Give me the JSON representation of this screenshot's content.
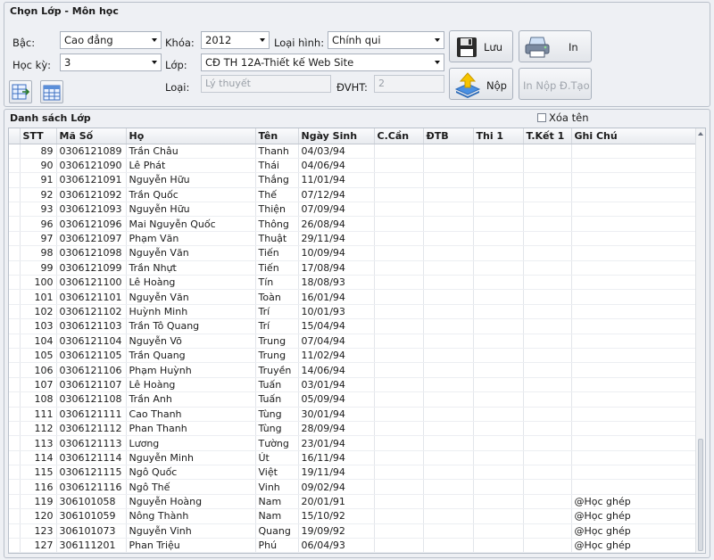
{
  "top": {
    "title": "Chọn Lớp - Môn học",
    "bac": {
      "label": "Bậc:",
      "value": "Cao đẳng"
    },
    "hocky": {
      "label": "Học kỳ:",
      "value": "3"
    },
    "khoa": {
      "label": "Khóa:",
      "value": "2012"
    },
    "loaihinh": {
      "label": "Loại hình:",
      "value": "Chính qui"
    },
    "lop": {
      "label": "Lớp:",
      "value": "CĐ TH 12A-Thiết kế Web Site"
    },
    "loai": {
      "label": "Loại:",
      "value": "Lý thuyết"
    },
    "dvht": {
      "label": "ĐVHT:",
      "value": "2"
    },
    "buttons": {
      "luu": "Lưu",
      "in": "In",
      "nop": "Nộp",
      "in_nop": "In Nộp Đ.Tạo"
    }
  },
  "list": {
    "title": "Danh sách Lớp",
    "xoa_ten_label": "Xóa tên",
    "columns": [
      "STT",
      "Mã Số",
      "Họ",
      "Tên",
      "Ngày Sinh",
      "C.Cần",
      "ĐTB",
      "Thi 1",
      "T.Kết 1",
      "Ghi Chú"
    ],
    "rows": [
      [
        "89",
        "0306121089",
        "Trần Châu",
        "Thanh",
        "04/03/94",
        "",
        "",
        "",
        "",
        ""
      ],
      [
        "90",
        "0306121090",
        "Lê Phát",
        "Thái",
        "04/06/94",
        "",
        "",
        "",
        "",
        ""
      ],
      [
        "91",
        "0306121091",
        "Nguyễn Hữu",
        "Thắng",
        "11/01/94",
        "",
        "",
        "",
        "",
        ""
      ],
      [
        "92",
        "0306121092",
        "Trần Quốc",
        "Thế",
        "07/12/94",
        "",
        "",
        "",
        "",
        ""
      ],
      [
        "93",
        "0306121093",
        "Nguyễn Hữu",
        "Thiện",
        "07/09/94",
        "",
        "",
        "",
        "",
        ""
      ],
      [
        "96",
        "0306121096",
        "Mai Nguyễn Quốc",
        "Thông",
        "26/08/94",
        "",
        "",
        "",
        "",
        ""
      ],
      [
        "97",
        "0306121097",
        "Phạm Văn",
        "Thuật",
        "29/11/94",
        "",
        "",
        "",
        "",
        ""
      ],
      [
        "98",
        "0306121098",
        "Nguyễn Văn",
        "Tiến",
        "10/09/94",
        "",
        "",
        "",
        "",
        ""
      ],
      [
        "99",
        "0306121099",
        "Trần Nhựt",
        "Tiến",
        "17/08/94",
        "",
        "",
        "",
        "",
        ""
      ],
      [
        "100",
        "0306121100",
        "Lê Hoàng",
        "Tín",
        "18/08/93",
        "",
        "",
        "",
        "",
        ""
      ],
      [
        "101",
        "0306121101",
        "Nguyễn Văn",
        "Toàn",
        "16/01/94",
        "",
        "",
        "",
        "",
        ""
      ],
      [
        "102",
        "0306121102",
        "Huỳnh Minh",
        "Trí",
        "10/01/93",
        "",
        "",
        "",
        "",
        ""
      ],
      [
        "103",
        "0306121103",
        "Trần Tô Quang",
        "Trí",
        "15/04/94",
        "",
        "",
        "",
        "",
        ""
      ],
      [
        "104",
        "0306121104",
        "Nguyễn Võ",
        "Trung",
        "07/04/94",
        "",
        "",
        "",
        "",
        ""
      ],
      [
        "105",
        "0306121105",
        "Trần Quang",
        "Trung",
        "11/02/94",
        "",
        "",
        "",
        "",
        ""
      ],
      [
        "106",
        "0306121106",
        "Phạm Huỳnh",
        "Truyền",
        "14/06/94",
        "",
        "",
        "",
        "",
        ""
      ],
      [
        "107",
        "0306121107",
        "Lê Hoàng",
        "Tuấn",
        "03/01/94",
        "",
        "",
        "",
        "",
        ""
      ],
      [
        "108",
        "0306121108",
        "Trần Anh",
        "Tuấn",
        "05/09/94",
        "",
        "",
        "",
        "",
        ""
      ],
      [
        "111",
        "0306121111",
        "Cao Thanh",
        "Tùng",
        "30/01/94",
        "",
        "",
        "",
        "",
        ""
      ],
      [
        "112",
        "0306121112",
        "Phan Thanh",
        "Tùng",
        "28/09/94",
        "",
        "",
        "",
        "",
        ""
      ],
      [
        "113",
        "0306121113",
        "Lương",
        "Tường",
        "23/01/94",
        "",
        "",
        "",
        "",
        ""
      ],
      [
        "114",
        "0306121114",
        "Nguyễn Minh",
        "Út",
        "16/11/94",
        "",
        "",
        "",
        "",
        ""
      ],
      [
        "115",
        "0306121115",
        "Ngô Quốc",
        "Việt",
        "19/11/94",
        "",
        "",
        "",
        "",
        ""
      ],
      [
        "116",
        "0306121116",
        "Ngô Thế",
        "Vinh",
        "09/02/94",
        "",
        "",
        "",
        "",
        ""
      ],
      [
        "119",
        "306101058",
        "Nguyễn Hoàng",
        "Nam",
        "20/01/91",
        "",
        "",
        "",
        "",
        "@Học ghép"
      ],
      [
        "120",
        "306101059",
        "Nông Thành",
        "Nam",
        "15/10/92",
        "",
        "",
        "",
        "",
        "@Học ghép"
      ],
      [
        "123",
        "306101073",
        "Nguyễn Vinh",
        "Quang",
        "19/09/92",
        "",
        "",
        "",
        "",
        "@Học ghép"
      ],
      [
        "127",
        "306111201",
        "Phan Triệu",
        "Phú",
        "06/04/93",
        "",
        "",
        "",
        "",
        "@Học ghép"
      ]
    ]
  },
  "icons": {
    "save": "floppy-disk-icon",
    "print": "printer-icon",
    "submit": "upload-arrow-icon",
    "export": "grid-export-icon",
    "calendar": "grid-calendar-icon"
  }
}
